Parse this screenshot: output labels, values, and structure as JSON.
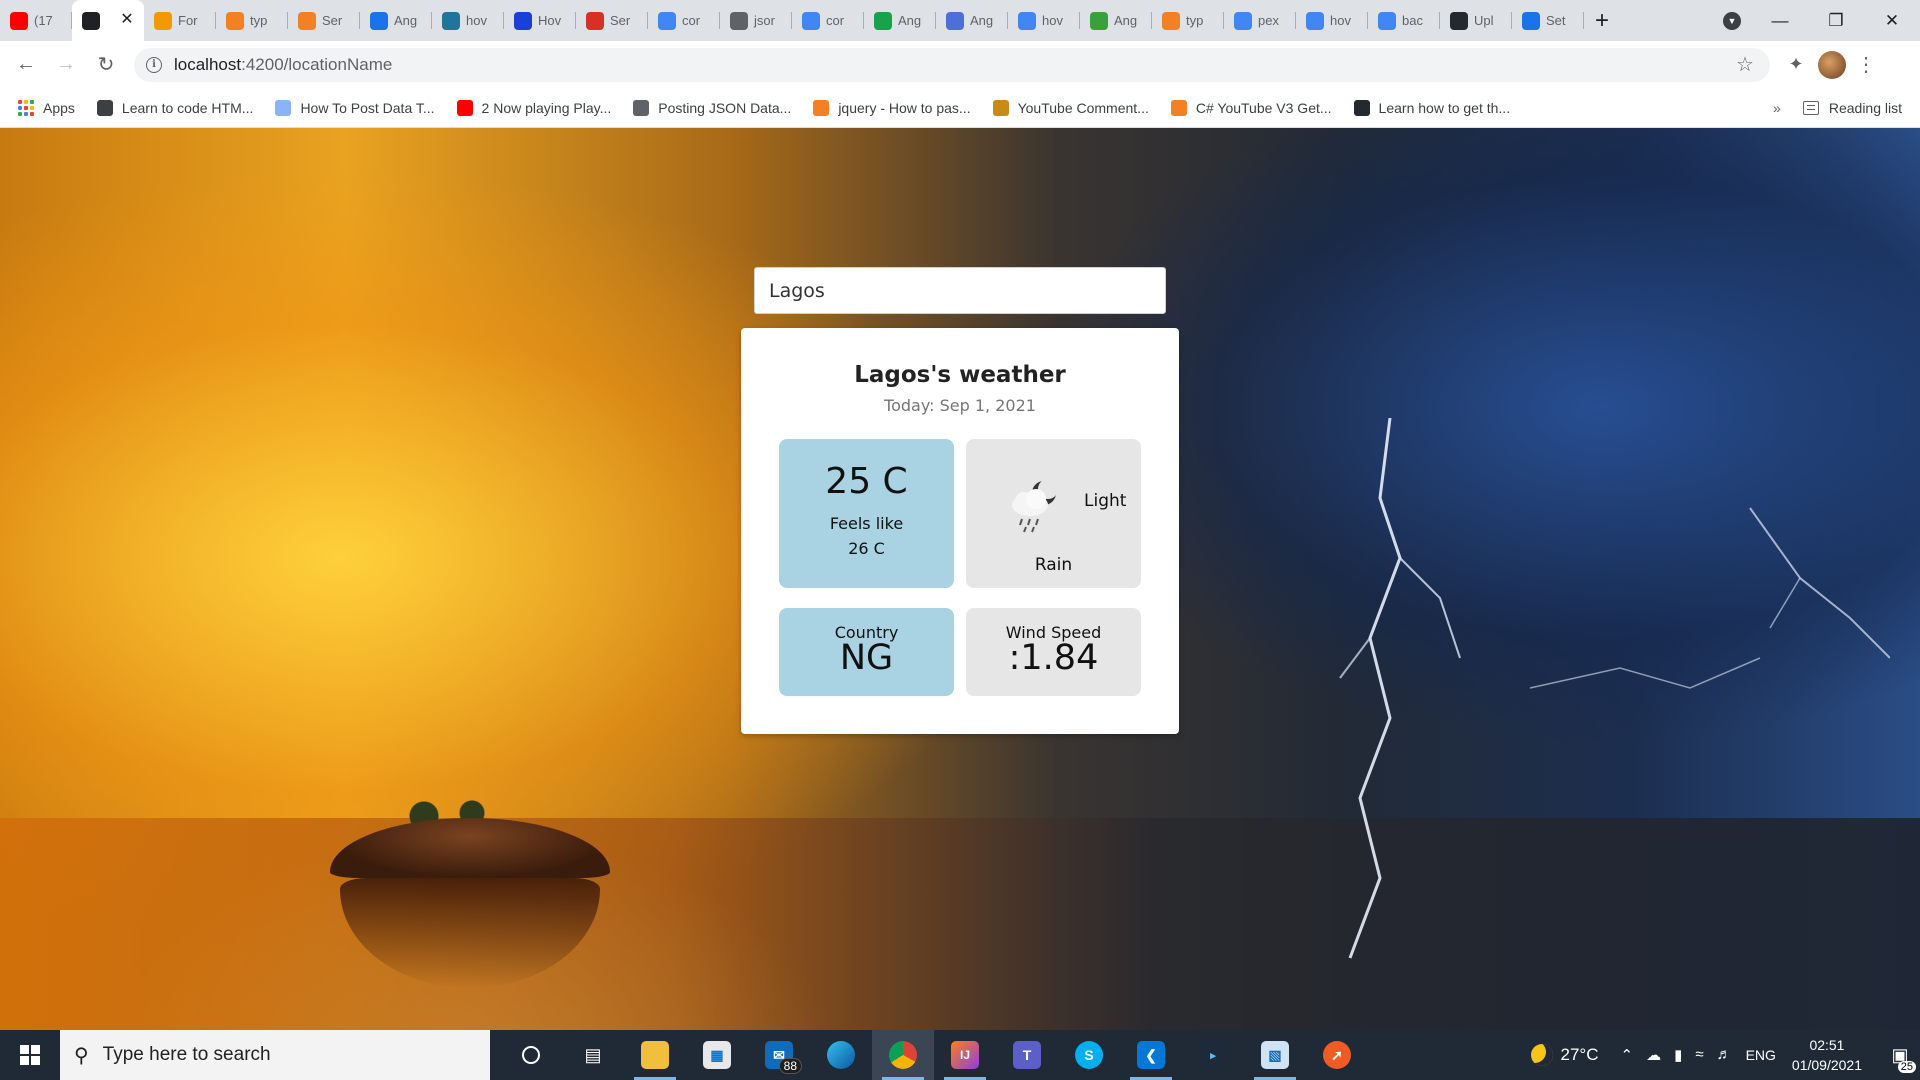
{
  "browser": {
    "tabs": [
      {
        "label": "(17",
        "icon": "youtube-icon",
        "color": "#ff0000"
      },
      {
        "label": "",
        "icon": "angular-icon",
        "color": "#202124",
        "active": true
      },
      {
        "label": "For",
        "icon": "shield-icon",
        "color": "#f29900"
      },
      {
        "label": "typ",
        "icon": "stackoverflow-icon",
        "color": "#f48024"
      },
      {
        "label": "Ser",
        "icon": "stackoverflow-icon",
        "color": "#f48024"
      },
      {
        "label": "Ang",
        "icon": "bolt-icon",
        "color": "#1a73e8"
      },
      {
        "label": "hov",
        "icon": "wordpress-icon",
        "color": "#21759b"
      },
      {
        "label": "Hov",
        "icon": "js-icon",
        "color": "#1c3fd8"
      },
      {
        "label": "Ser",
        "icon": "gmail-icon",
        "color": "#d93025"
      },
      {
        "label": "cor",
        "icon": "google-icon",
        "color": "#4285f4"
      },
      {
        "label": "jsor",
        "icon": "globe-icon",
        "color": "#5f6368"
      },
      {
        "label": "cor",
        "icon": "google-icon",
        "color": "#4285f4"
      },
      {
        "label": "Ang",
        "icon": "djam-icon",
        "color": "#16a34a"
      },
      {
        "label": "Ang",
        "icon": "react-icon",
        "color": "#4d6fd9"
      },
      {
        "label": "hov",
        "icon": "google-icon",
        "color": "#4285f4"
      },
      {
        "label": "Ang",
        "icon": "leaf-icon",
        "color": "#3aa13a"
      },
      {
        "label": "typ",
        "icon": "stackoverflow-icon",
        "color": "#f48024"
      },
      {
        "label": "pex",
        "icon": "google-icon",
        "color": "#4285f4"
      },
      {
        "label": "hov",
        "icon": "google-icon",
        "color": "#4285f4"
      },
      {
        "label": "bac",
        "icon": "google-icon",
        "color": "#4285f4"
      },
      {
        "label": "Upl",
        "icon": "github-icon",
        "color": "#24292f"
      },
      {
        "label": "Set",
        "icon": "gear-icon",
        "color": "#1a73e8"
      }
    ],
    "url_host": "localhost",
    "url_path": ":4200/locationName",
    "bookmarks": [
      {
        "label": "Apps",
        "icon": "apps-grid-icon"
      },
      {
        "label": "Learn to code HTM...",
        "icon": "freecodecamp-icon",
        "color": "#3c4043"
      },
      {
        "label": "How To Post Data T...",
        "icon": "page-icon",
        "color": "#8ab4f8"
      },
      {
        "label": "2 Now playing Play...",
        "icon": "youtube-icon",
        "color": "#ff0000"
      },
      {
        "label": "Posting JSON Data...",
        "icon": "folder-icon",
        "color": "#5f6368"
      },
      {
        "label": "jquery - How to pas...",
        "icon": "stackoverflow-icon",
        "color": "#f48024"
      },
      {
        "label": "YouTube Comment...",
        "icon": "badge-icon",
        "color": "#c98a1a"
      },
      {
        "label": "C# YouTube V3 Get...",
        "icon": "stackoverflow-icon",
        "color": "#f48024"
      },
      {
        "label": "Learn how to get th...",
        "icon": "github-icon",
        "color": "#24292f"
      }
    ],
    "more_bookmarks": "»",
    "reading_list": "Reading list"
  },
  "app": {
    "search_value": "Lagos",
    "title": "Lagos's weather",
    "date": "Today: Sep 1, 2021",
    "temperature": "25 C",
    "feels_like_label": "Feels like",
    "feels_like_value": "26 C",
    "description_word1": "Light",
    "description_word2": "Rain",
    "weather_icon": "rain-cloud-night-icon",
    "country_label": "Country",
    "country_value": "NG",
    "wind_label": "Wind Speed",
    "wind_value": ":1.84",
    "colors": {
      "tile_blue": "#a9d3e3",
      "tile_gray": "#e6e6e6"
    }
  },
  "taskbar": {
    "search_placeholder": "Type here to search",
    "mail_badge": "88",
    "weather_temp": "27°C",
    "language": "ENG",
    "time": "02:51",
    "date": "01/09/2021",
    "notification_count": "25"
  }
}
